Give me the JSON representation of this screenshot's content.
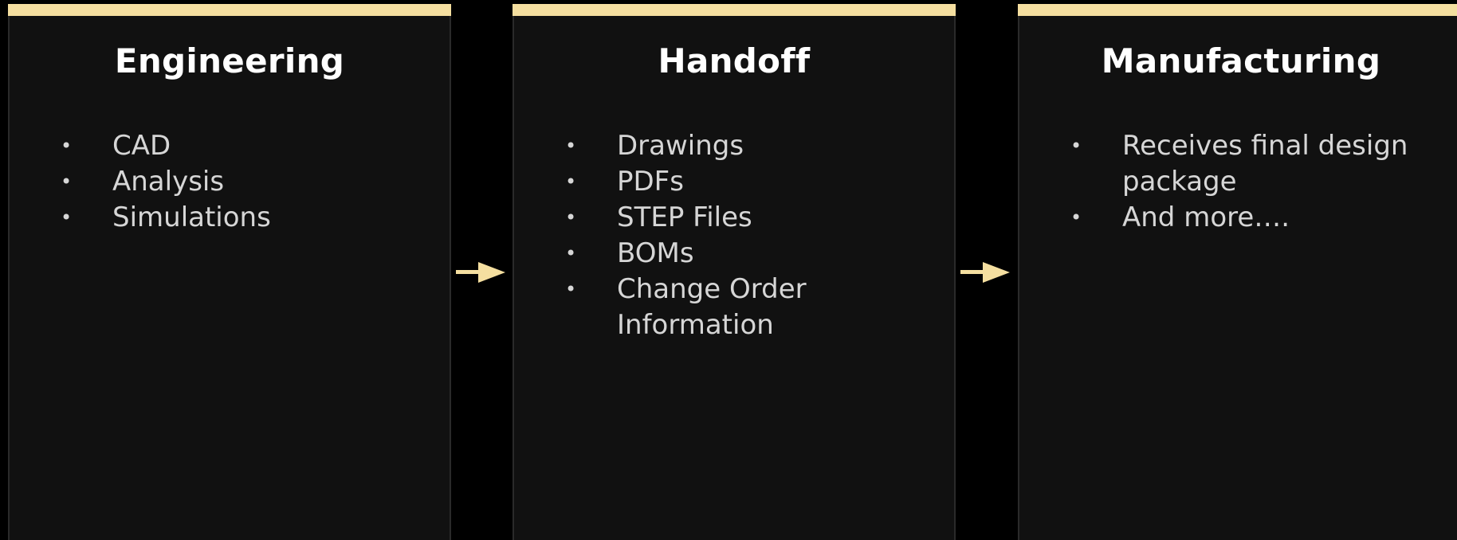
{
  "colors": {
    "background": "#000000",
    "panel": "#111111",
    "accent": "#f5dfa0",
    "title_text": "#ffffff",
    "body_text": "#d6d6d6"
  },
  "panels": [
    {
      "title": "Engineering",
      "items": [
        "CAD",
        "Analysis",
        "Simulations"
      ]
    },
    {
      "title": "Handoff",
      "items": [
        "Drawings",
        "PDFs",
        "STEP Files",
        "BOMs",
        "Change Order Information"
      ]
    },
    {
      "title": "Manufacturing",
      "items": [
        "Receives final design package",
        "And more…."
      ]
    }
  ],
  "connectors": [
    {
      "from": "Engineering",
      "to": "Handoff",
      "icon": "arrow-right-icon"
    },
    {
      "from": "Handoff",
      "to": "Manufacturing",
      "icon": "arrow-right-icon"
    }
  ]
}
